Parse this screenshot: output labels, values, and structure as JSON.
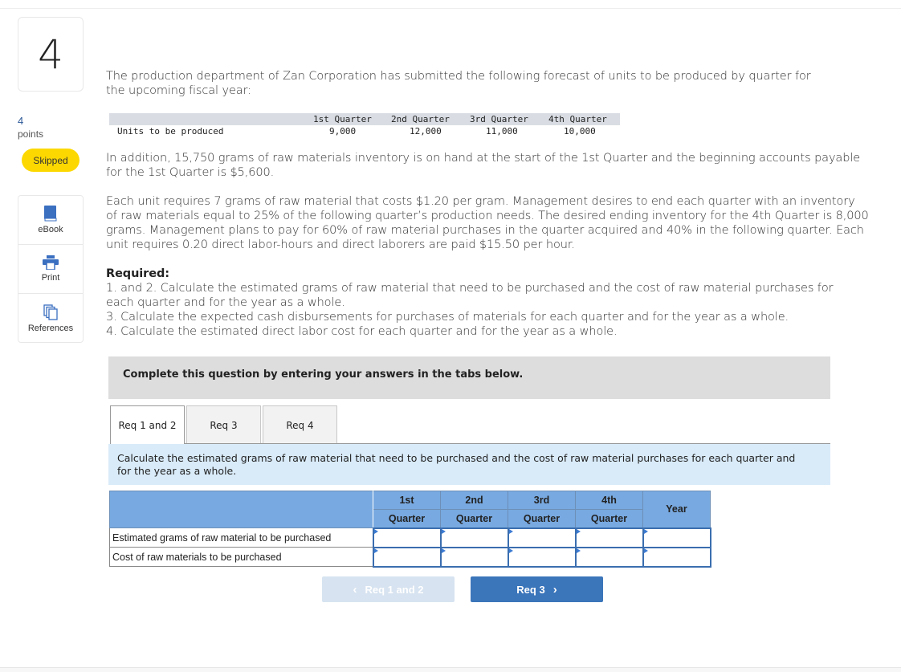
{
  "question": {
    "number": "4",
    "points_value": "4",
    "points_label": "points",
    "status_badge": "Skipped"
  },
  "tools": [
    {
      "label": "eBook",
      "icon": "book-icon"
    },
    {
      "label": "Print",
      "icon": "printer-icon"
    },
    {
      "label": "References",
      "icon": "copy-pages-icon"
    }
  ],
  "problem": {
    "intro": "The production department of Zan Corporation has submitted the following forecast of units to be produced by quarter for the upcoming fiscal year:",
    "units_table": {
      "headers": [
        "1st Quarter",
        "2nd Quarter",
        "3rd Quarter",
        "4th Quarter"
      ],
      "row_label": "Units to be produced",
      "values": [
        "9,000",
        "12,000",
        "11,000",
        "10,000"
      ]
    },
    "paragraph2": "In addition, 15,750 grams of raw materials inventory is on hand at the start of the 1st Quarter and the beginning accounts payable for the 1st Quarter is $5,600.",
    "paragraph3": "Each unit requires 7 grams of raw material that costs $1.20 per gram. Management desires to end each quarter with an inventory of raw materials equal to 25% of the following quarter’s production needs. The desired ending inventory for the 4th Quarter is 8,000 grams. Management plans to pay for 60% of raw material purchases in the quarter acquired and 40% in the following quarter. Each unit requires 0.20 direct labor-hours and direct laborers are paid $15.50 per hour.",
    "required_heading": "Required:",
    "required_items": [
      "1. and 2. Calculate the estimated grams of raw material that need to be purchased and the cost of raw material purchases for each quarter and for the year as a whole.",
      "3. Calculate the expected cash disbursements for purchases of materials for each quarter and for the year as a whole.",
      "4. Calculate the estimated direct labor cost for each quarter and for the year as a whole."
    ]
  },
  "banner": "Complete this question by entering your answers in the tabs below.",
  "tabs": [
    {
      "label": "Req 1 and 2",
      "active": true
    },
    {
      "label": "Req 3",
      "active": false
    },
    {
      "label": "Req 4",
      "active": false
    }
  ],
  "tab_instruction": "Calculate the estimated grams of raw material that need to be purchased and the cost of raw material purchases for each quarter and for the year as a whole.",
  "answer_table": {
    "col_top": [
      "1st",
      "2nd",
      "3rd",
      "4th"
    ],
    "col_bottom": [
      "Quarter",
      "Quarter",
      "Quarter",
      "Quarter"
    ],
    "year_label": "Year",
    "rows": [
      {
        "label": "Estimated grams of raw material to be purchased",
        "values": [
          "",
          "",
          "",
          "",
          ""
        ]
      },
      {
        "label": "Cost of raw materials to be purchased",
        "values": [
          "",
          "",
          "",
          "",
          ""
        ]
      }
    ]
  },
  "nav": {
    "prev_label": "Req 1 and 2",
    "next_label": "Req 3",
    "prev_icon": "chevron-left-icon",
    "next_icon": "chevron-right-icon"
  },
  "colors": {
    "badge": "#fcd800",
    "table_header": "#78a9e0",
    "next_button": "#3b75ba",
    "instruction_bg": "#d9ebf9"
  }
}
